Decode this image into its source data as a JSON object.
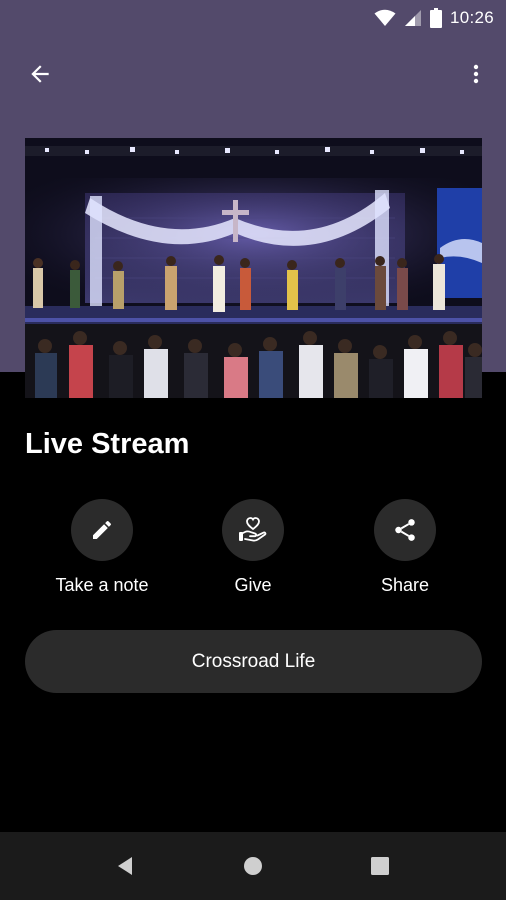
{
  "status_bar": {
    "time": "10:26",
    "icons": [
      "wifi-icon",
      "cellular-signal-icon",
      "battery-icon"
    ]
  },
  "app_bar": {
    "back_icon": "arrow-left-icon",
    "menu_icon": "more-vertical-icon"
  },
  "hero": {
    "description_icon": "worship-stage-photo"
  },
  "content": {
    "title": "Live Stream",
    "actions": [
      {
        "label": "Take a note",
        "icon": "pencil-icon"
      },
      {
        "label": "Give",
        "icon": "heart-hand-icon"
      },
      {
        "label": "Share",
        "icon": "share-icon"
      }
    ],
    "primary_button": "Crossroad Life"
  },
  "nav_bar": {
    "icons": [
      "back-triangle-icon",
      "home-circle-icon",
      "recents-square-icon"
    ]
  },
  "colors": {
    "header_bg": "#534a6b",
    "page_bg": "#000000",
    "button_bg": "#2b2b2b",
    "nav_bg": "#1b1b1b"
  }
}
